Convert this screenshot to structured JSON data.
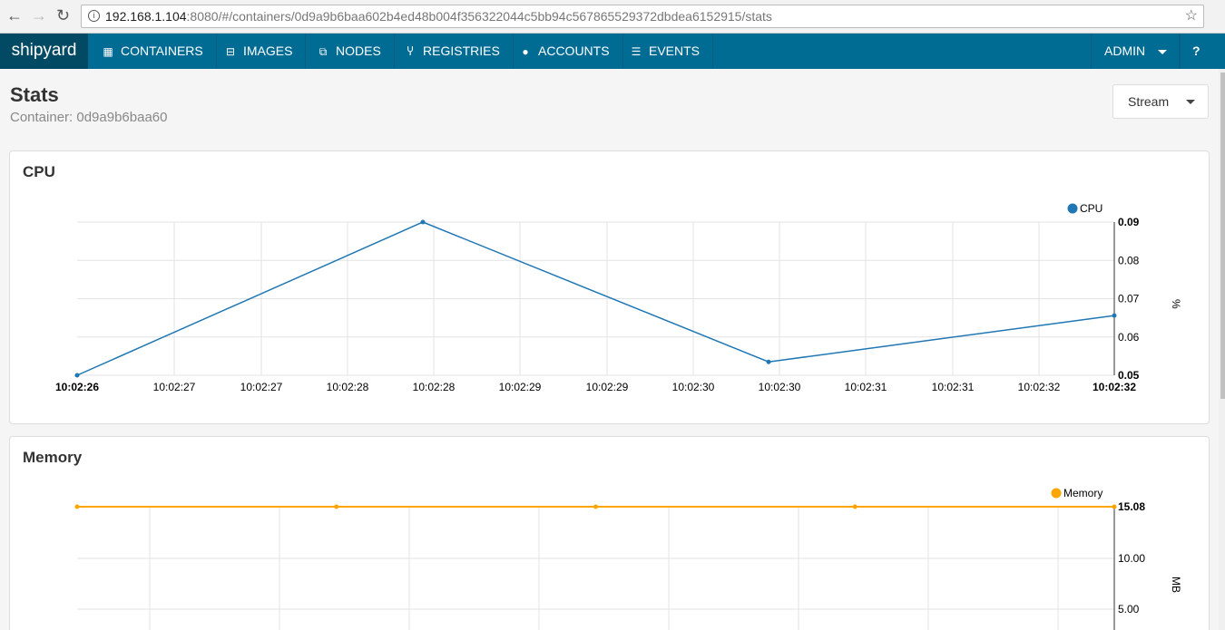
{
  "browser": {
    "url_host": "192.168.1.104",
    "url_rest": ":8080/#/containers/0d9a9b6baa602b4ed48b004f356322044c5bb94c567865529372dbdea6152915/stats"
  },
  "nav": {
    "logo": "shipyard",
    "items": [
      {
        "label": "CONTAINERS",
        "icon": "grid-icon",
        "glyph": "▦"
      },
      {
        "label": "IMAGES",
        "icon": "hdd-icon",
        "glyph": "⊟"
      },
      {
        "label": "NODES",
        "icon": "sitemap-icon",
        "glyph": "⧉"
      },
      {
        "label": "REGISTRIES",
        "icon": "fork-icon",
        "glyph": "Ⴤ"
      },
      {
        "label": "ACCOUNTS",
        "icon": "user-icon",
        "glyph": "●"
      },
      {
        "label": "EVENTS",
        "icon": "list-icon",
        "glyph": "☰"
      }
    ],
    "user": "ADMIN",
    "help": "?"
  },
  "page": {
    "title": "Stats",
    "subtitle": "Container: 0d9a9b6baa60",
    "stream_label": "Stream"
  },
  "chart_data": [
    {
      "type": "line",
      "title": "CPU",
      "ylabel": "%",
      "legend": "top-right",
      "series": [
        {
          "name": "CPU",
          "color": "#1f77b4",
          "points": [
            [
              "10:02:26",
              0.05
            ],
            [
              "10:02:28",
              0.09
            ],
            [
              "10:02:30",
              0.0535
            ],
            [
              "10:02:32",
              0.0656
            ]
          ]
        }
      ],
      "ylim": [
        0.05,
        0.09
      ],
      "yticks": [
        "0.09",
        "0.08",
        "0.07",
        "0.06",
        "0.05"
      ],
      "xticks": [
        "10:02:26",
        "10:02:27",
        "10:02:27",
        "10:02:28",
        "10:02:28",
        "10:02:29",
        "10:02:29",
        "10:02:30",
        "10:02:30",
        "10:02:31",
        "10:02:31",
        "10:02:32",
        "10:02:32"
      ],
      "grid": true
    },
    {
      "type": "line",
      "title": "Memory",
      "ylabel": "MB",
      "legend": "top-right",
      "series": [
        {
          "name": "Memory",
          "color": "#ffa500",
          "values": [
            15.08,
            15.08,
            15.08,
            15.08,
            15.08
          ]
        }
      ],
      "yticks": [
        "15.08",
        "10.00",
        "5.00"
      ],
      "grid": true
    }
  ]
}
